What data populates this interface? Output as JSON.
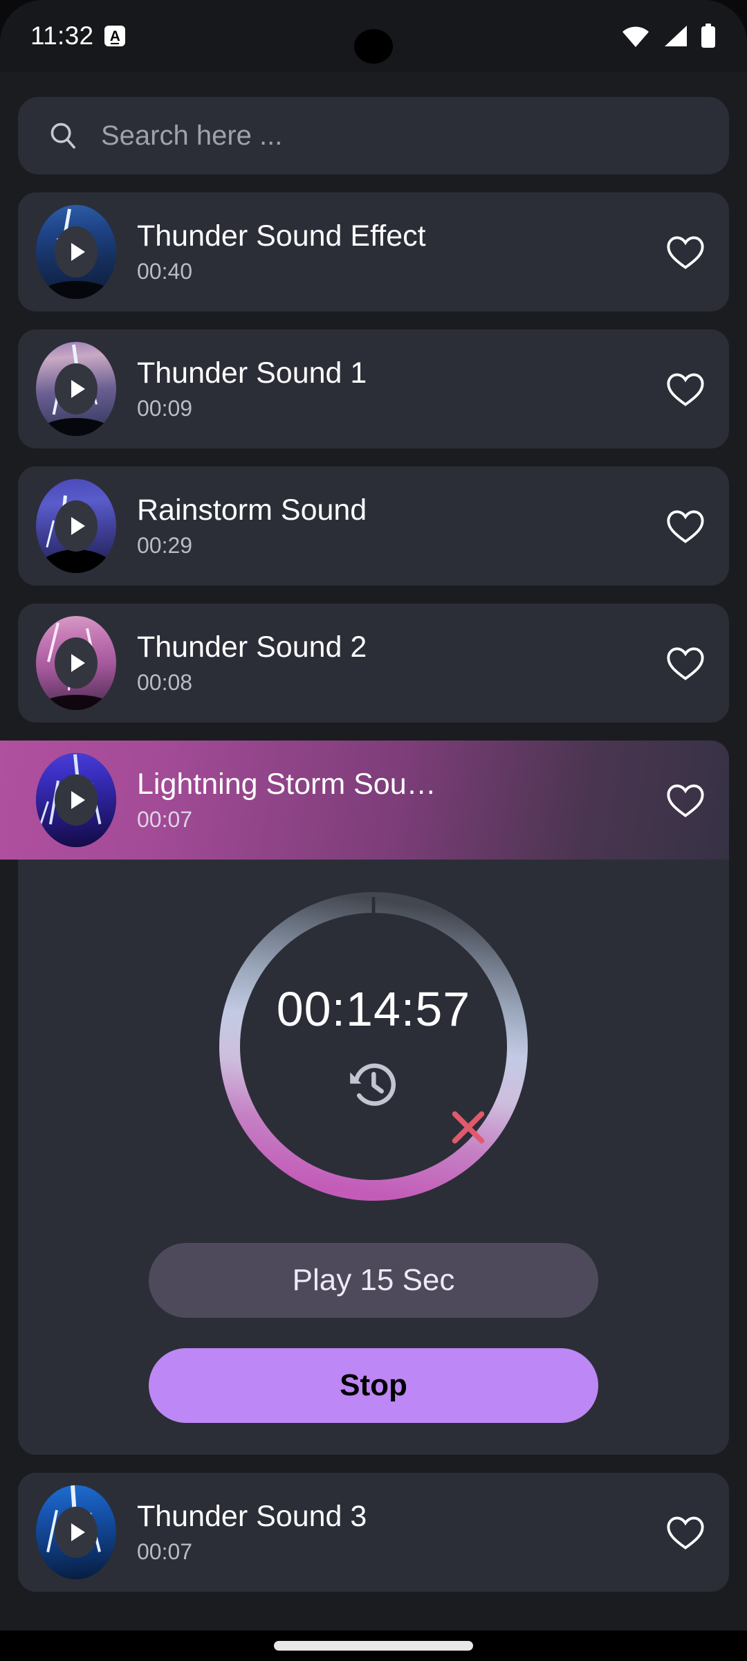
{
  "status_bar": {
    "time": "11:32",
    "badge_letter": "A",
    "icons": [
      "wifi-icon",
      "cellular-signal-icon",
      "battery-icon"
    ]
  },
  "search": {
    "placeholder": "Search here ...",
    "value": "",
    "icon": "search-icon"
  },
  "sounds": [
    {
      "title": "Thunder Sound Effect",
      "duration": "00:40",
      "favorite": false,
      "selected": false,
      "thumb": "blue"
    },
    {
      "title": "Thunder Sound 1",
      "duration": "00:09",
      "favorite": false,
      "selected": false,
      "thumb": "violet"
    },
    {
      "title": "Rainstorm Sound",
      "duration": "00:29",
      "favorite": false,
      "selected": false,
      "thumb": "indigo"
    },
    {
      "title": "Thunder Sound 2",
      "duration": "00:08",
      "favorite": false,
      "selected": false,
      "thumb": "pink"
    },
    {
      "title": "Lightning Storm Sou…",
      "duration": "00:07",
      "favorite": false,
      "selected": true,
      "thumb": "electric"
    },
    {
      "title": "Thunder Sound 3",
      "duration": "00:07",
      "favorite": false,
      "selected": false,
      "thumb": "brightblue"
    }
  ],
  "timer": {
    "remaining": "00:14:57",
    "reset_icon": "history-restore-icon",
    "close_icon": "close-icon",
    "ring_colors": {
      "start": "#4b4f58",
      "steel": "#8e9aac",
      "lavender": "#c9cdea",
      "end": "#c163b8"
    }
  },
  "buttons": {
    "play": "Play 15 Sec",
    "stop": "Stop",
    "play_bg": "#4e4a5c",
    "stop_bg": "#bd87f5"
  },
  "nav": {
    "gesture_pill": "home-indicator"
  },
  "theme": {
    "page_bg": "#1b1c20",
    "card_bg": "#2b2e37",
    "accent": "#bd87f5",
    "danger": "#e05a6e"
  }
}
